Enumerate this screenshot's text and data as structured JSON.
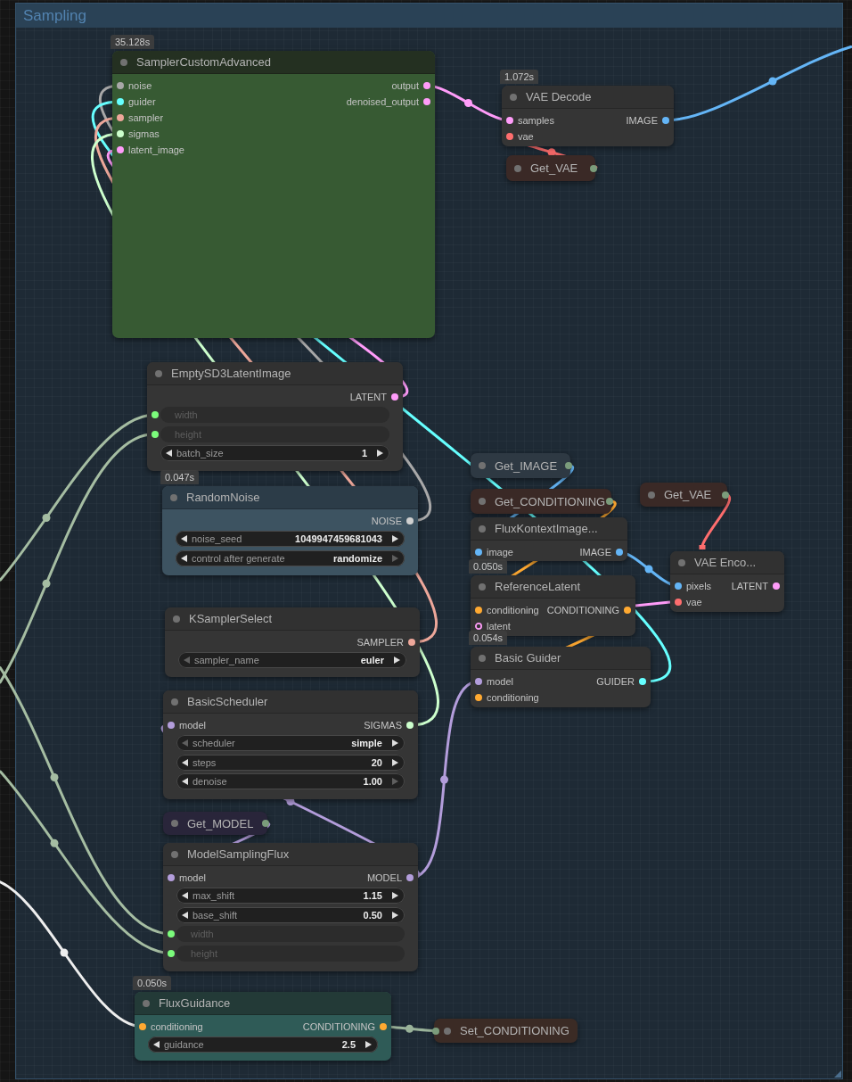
{
  "group": {
    "title": "Sampling"
  },
  "nodes": [
    {
      "kind": "node",
      "title": "SamplerCustomAdvanced",
      "timing": "35.128s",
      "header": {
        "color": "#243021"
      },
      "color": "#375a33",
      "inputs": [
        {
          "label": "noise",
          "color": "#a8a8a8",
          "optional": false
        },
        {
          "label": "guider",
          "color": "#66ffff",
          "optional": false
        },
        {
          "label": "sampler",
          "color": "#eda79a",
          "optional": false
        },
        {
          "label": "sigmas",
          "color": "#cdffcd",
          "optional": false
        },
        {
          "label": "latent_image",
          "color": "#ff9cf9",
          "optional": false
        }
      ],
      "outputs": [
        {
          "label": "output",
          "color": "#ff9cf9"
        },
        {
          "label": "denoised_output",
          "color": "#ff9cf9"
        }
      ]
    },
    {
      "kind": "node",
      "title": "VAE Decode",
      "timing": "1.072s",
      "header": {
        "color": "#313131"
      },
      "color": "#353535",
      "inputs": [
        {
          "label": "samples",
          "color": "#ff9cf9",
          "optional": false
        },
        {
          "label": "vae",
          "color": "#ff6e6e",
          "optional": false
        }
      ],
      "outputs": [
        {
          "label": "IMAGE",
          "color": "#64b5f6"
        }
      ]
    },
    {
      "kind": "getter",
      "title": "Get_VAE",
      "color": "#3a2926",
      "port": {
        "kind": "output",
        "color": "#7b9c7b"
      }
    },
    {
      "kind": "node",
      "title": "EmptySD3LatentImage",
      "header": {
        "color": "#313131"
      },
      "color": "#353535",
      "outputs": [
        {
          "label": "LATENT",
          "color": "#ff9cf9"
        }
      ],
      "widgets": [
        {
          "kind": "linked",
          "label": "width",
          "color": "#7cfc7c"
        },
        {
          "kind": "linked",
          "label": "height",
          "color": "#7cfc7c"
        },
        {
          "kind": "stepper",
          "label": "batch_size",
          "value": "1",
          "prev_disabled": false,
          "next_disabled": false
        }
      ]
    },
    {
      "kind": "getter",
      "title": "Get_IMAGE",
      "color": "#2e3943",
      "port": {
        "kind": "output",
        "color": "#7b9c7b"
      }
    },
    {
      "kind": "getter",
      "title": "Get_VAE",
      "color": "#3a2926",
      "port": {
        "kind": "output",
        "color": "#7b9c7b"
      }
    },
    {
      "kind": "node",
      "title": "RandomNoise",
      "timing": "0.047s",
      "header": {
        "color": "#2c3c48"
      },
      "color": "#3d5361",
      "outputs": [
        {
          "label": "NOISE",
          "color": "#d0d0d0"
        }
      ],
      "widgets": [
        {
          "kind": "stepper",
          "label": "noise_seed",
          "value": "1049947459681043",
          "prev_disabled": false,
          "next_disabled": false
        },
        {
          "kind": "stepper",
          "label": "control after generate",
          "value": "randomize",
          "prev_disabled": false,
          "next_disabled": true
        }
      ]
    },
    {
      "kind": "getter",
      "title": "Get_CONDITIONING",
      "color": "#3a2926",
      "port": {
        "kind": "output",
        "color": "#7b9c7b"
      }
    },
    {
      "kind": "node",
      "title": "FluxKontextImage...",
      "header": {
        "color": "#313131"
      },
      "color": "#353535",
      "inputs": [
        {
          "label": "image",
          "color": "#64b5f6",
          "optional": false
        }
      ],
      "outputs": [
        {
          "label": "IMAGE",
          "color": "#64b5f6"
        }
      ]
    },
    {
      "kind": "node",
      "title": "ReferenceLatent",
      "timing": "0.050s",
      "header": {
        "color": "#313131"
      },
      "color": "#353535",
      "inputs": [
        {
          "label": "conditioning",
          "color": "#ffa931",
          "optional": false
        },
        {
          "label": "latent",
          "color": "#ff9cf9",
          "optional": true
        }
      ],
      "outputs": [
        {
          "label": "CONDITIONING",
          "color": "#ffa931"
        }
      ]
    },
    {
      "kind": "node",
      "title": "VAE Enco...",
      "header": {
        "color": "#313131"
      },
      "color": "#353535",
      "inputs": [
        {
          "label": "pixels",
          "color": "#64b5f6",
          "optional": false
        },
        {
          "label": "vae",
          "color": "#ff6e6e",
          "optional": false
        }
      ],
      "outputs": [
        {
          "label": "LATENT",
          "color": "#ff9cf9"
        }
      ]
    },
    {
      "kind": "node",
      "title": "KSamplerSelect",
      "header": {
        "color": "#313131"
      },
      "color": "#353535",
      "outputs": [
        {
          "label": "SAMPLER",
          "color": "#eda79a"
        }
      ],
      "widgets": [
        {
          "kind": "stepper",
          "label": "sampler_name",
          "value": "euler",
          "prev_disabled": true,
          "next_disabled": false
        }
      ]
    },
    {
      "kind": "node",
      "title": "Basic Guider",
      "timing": "0.054s",
      "header": {
        "color": "#313131"
      },
      "color": "#353535",
      "inputs": [
        {
          "label": "model",
          "color": "#b39ddb",
          "optional": false
        },
        {
          "label": "conditioning",
          "color": "#ffa931",
          "optional": false
        }
      ],
      "outputs": [
        {
          "label": "GUIDER",
          "color": "#66ffff"
        }
      ]
    },
    {
      "kind": "node",
      "title": "BasicScheduler",
      "header": {
        "color": "#313131"
      },
      "color": "#353535",
      "inputs": [
        {
          "label": "model",
          "color": "#b39ddb",
          "optional": false
        }
      ],
      "outputs": [
        {
          "label": "SIGMAS",
          "color": "#cdffcd"
        }
      ],
      "widgets": [
        {
          "kind": "stepper",
          "label": "scheduler",
          "value": "simple",
          "prev_disabled": true,
          "next_disabled": false
        },
        {
          "kind": "stepper",
          "label": "steps",
          "value": "20",
          "prev_disabled": false,
          "next_disabled": false
        },
        {
          "kind": "stepper",
          "label": "denoise",
          "value": "1.00",
          "prev_disabled": false,
          "next_disabled": true
        }
      ]
    },
    {
      "kind": "getter",
      "title": "Get_MODEL",
      "color": "#29253a",
      "port": {
        "kind": "output",
        "color": "#7b9c7b"
      }
    },
    {
      "kind": "node",
      "title": "ModelSamplingFlux",
      "header": {
        "color": "#313131"
      },
      "color": "#353535",
      "inputs": [
        {
          "label": "model",
          "color": "#b39ddb",
          "optional": false
        }
      ],
      "outputs": [
        {
          "label": "MODEL",
          "color": "#b39ddb"
        }
      ],
      "widgets": [
        {
          "kind": "stepper",
          "label": "max_shift",
          "value": "1.15",
          "prev_disabled": false,
          "next_disabled": false
        },
        {
          "kind": "stepper",
          "label": "base_shift",
          "value": "0.50",
          "prev_disabled": false,
          "next_disabled": false
        },
        {
          "kind": "linked",
          "label": "width",
          "color": "#7cfc7c"
        },
        {
          "kind": "linked",
          "label": "height",
          "color": "#7cfc7c"
        }
      ]
    },
    {
      "kind": "node",
      "title": "FluxGuidance",
      "timing": "0.050s",
      "header": {
        "color": "#233a37"
      },
      "color": "#2f5b57",
      "inputs": [
        {
          "label": "conditioning",
          "color": "#ffa931",
          "optional": false
        }
      ],
      "outputs": [
        {
          "label": "CONDITIONING",
          "color": "#ffa931"
        }
      ],
      "widgets": [
        {
          "kind": "stepper",
          "label": "guidance",
          "value": "2.5",
          "prev_disabled": false,
          "next_disabled": false
        }
      ]
    },
    {
      "kind": "getter",
      "title": "Set_CONDITIONING",
      "color": "#3b2b25",
      "port": {
        "kind": "input",
        "color": "#7b9c7b"
      }
    }
  ]
}
